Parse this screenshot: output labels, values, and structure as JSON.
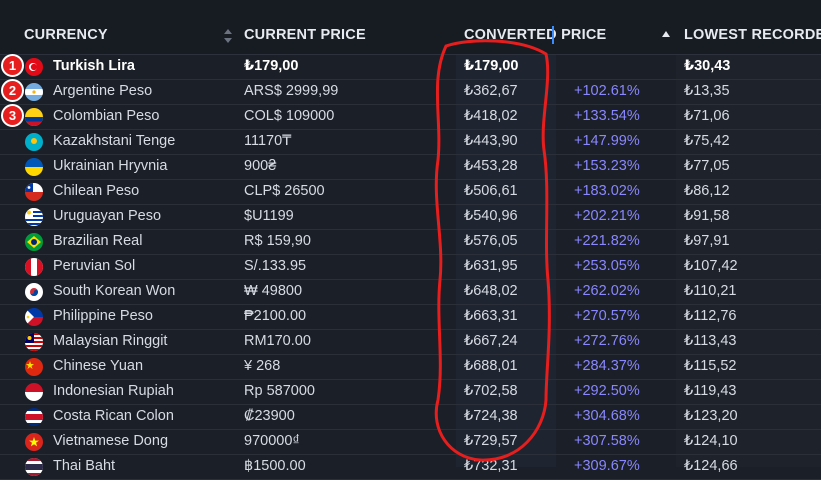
{
  "header": {
    "currency": "CURRENCY",
    "current_price": "CURRENT PRICE",
    "converted_price": "CONVERTED PRICE",
    "lowest_recorded": "LOWEST RECORDED"
  },
  "colors": {
    "pct": "#8a87ff",
    "annotation": "#e61e1e",
    "background": "#1b1f27"
  },
  "badges": [
    "1",
    "2",
    "3"
  ],
  "rows": [
    {
      "flag": "turkey-flag-icon",
      "name": "Turkish Lira",
      "price": "₺179,00",
      "converted": "₺179,00",
      "pct": "",
      "lowest": "₺30,43"
    },
    {
      "flag": "argentina-flag-icon",
      "name": "Argentine Peso",
      "price": "ARS$ 2999,99",
      "converted": "₺362,67",
      "pct": "+102.61%",
      "lowest": "₺13,35"
    },
    {
      "flag": "colombia-flag-icon",
      "name": "Colombian Peso",
      "price": "COL$ 109000",
      "converted": "₺418,02",
      "pct": "+133.54%",
      "lowest": "₺71,06"
    },
    {
      "flag": "kazakhstan-flag-icon",
      "name": "Kazakhstani Tenge",
      "price": "11170₸",
      "converted": "₺443,90",
      "pct": "+147.99%",
      "lowest": "₺75,42"
    },
    {
      "flag": "ukraine-flag-icon",
      "name": "Ukrainian Hryvnia",
      "price": "900₴",
      "converted": "₺453,28",
      "pct": "+153.23%",
      "lowest": "₺77,05"
    },
    {
      "flag": "chile-flag-icon",
      "name": "Chilean Peso",
      "price": "CLP$ 26500",
      "converted": "₺506,61",
      "pct": "+183.02%",
      "lowest": "₺86,12"
    },
    {
      "flag": "uruguay-flag-icon",
      "name": "Uruguayan Peso",
      "price": "$U1199",
      "converted": "₺540,96",
      "pct": "+202.21%",
      "lowest": "₺91,58"
    },
    {
      "flag": "brazil-flag-icon",
      "name": "Brazilian Real",
      "price": "R$ 159,90",
      "converted": "₺576,05",
      "pct": "+221.82%",
      "lowest": "₺97,91"
    },
    {
      "flag": "peru-flag-icon",
      "name": "Peruvian Sol",
      "price": "S/.133.95",
      "converted": "₺631,95",
      "pct": "+253.05%",
      "lowest": "₺107,42"
    },
    {
      "flag": "south-korea-flag-icon",
      "name": "South Korean Won",
      "price": "₩ 49800",
      "converted": "₺648,02",
      "pct": "+262.02%",
      "lowest": "₺110,21"
    },
    {
      "flag": "philippines-flag-icon",
      "name": "Philippine Peso",
      "price": "₱2100.00",
      "converted": "₺663,31",
      "pct": "+270.57%",
      "lowest": "₺112,76"
    },
    {
      "flag": "malaysia-flag-icon",
      "name": "Malaysian Ringgit",
      "price": "RM170.00",
      "converted": "₺667,24",
      "pct": "+272.76%",
      "lowest": "₺113,43"
    },
    {
      "flag": "china-flag-icon",
      "name": "Chinese Yuan",
      "price": "¥ 268",
      "converted": "₺688,01",
      "pct": "+284.37%",
      "lowest": "₺115,52"
    },
    {
      "flag": "indonesia-flag-icon",
      "name": "Indonesian Rupiah",
      "price": "Rp 587000",
      "converted": "₺702,58",
      "pct": "+292.50%",
      "lowest": "₺119,43"
    },
    {
      "flag": "costa-rica-flag-icon",
      "name": "Costa Rican Colon",
      "price": "₡23900",
      "converted": "₺724,38",
      "pct": "+304.68%",
      "lowest": "₺123,20"
    },
    {
      "flag": "vietnam-flag-icon",
      "name": "Vietnamese Dong",
      "price": "970000₫",
      "converted": "₺729,57",
      "pct": "+307.58%",
      "lowest": "₺124,10"
    },
    {
      "flag": "thailand-flag-icon",
      "name": "Thai Baht",
      "price": "฿1500.00",
      "converted": "₺732,31",
      "pct": "+309.67%",
      "lowest": "₺124,66"
    }
  ]
}
